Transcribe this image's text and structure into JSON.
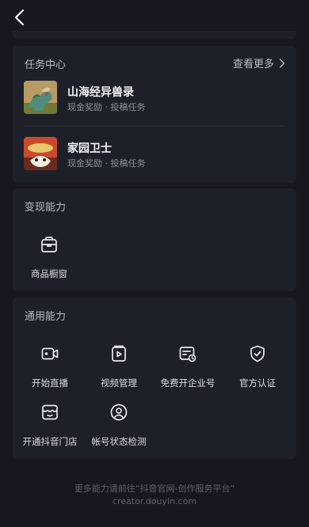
{
  "tasks": {
    "title": "任务中心",
    "more": "查看更多",
    "items": [
      {
        "name": "山海经异兽录",
        "sub": "现金奖励 · 投稿任务"
      },
      {
        "name": "家园卫士",
        "sub": "现金奖励 · 投稿任务"
      }
    ]
  },
  "monetize": {
    "title": "变现能力",
    "tools": [
      {
        "label": "商品橱窗",
        "icon": "shop-window-icon"
      }
    ]
  },
  "general": {
    "title": "通用能力",
    "tools": [
      {
        "label": "开始直播",
        "icon": "live-camera-icon"
      },
      {
        "label": "视频管理",
        "icon": "video-manage-icon"
      },
      {
        "label": "免费开企业号",
        "icon": "enterprise-account-icon"
      },
      {
        "label": "官方认证",
        "icon": "official-verify-icon"
      },
      {
        "label": "开通抖音门店",
        "icon": "store-icon"
      },
      {
        "label": "帐号状态检测",
        "icon": "account-status-icon"
      }
    ]
  },
  "footer": {
    "line1": "更多能力请前往“抖音官网-创作服务平台”",
    "line2": "creator.douyin.com"
  },
  "colors": {
    "background": "#16171f",
    "card": "#1e2029",
    "muted_text": "#8e909b"
  }
}
